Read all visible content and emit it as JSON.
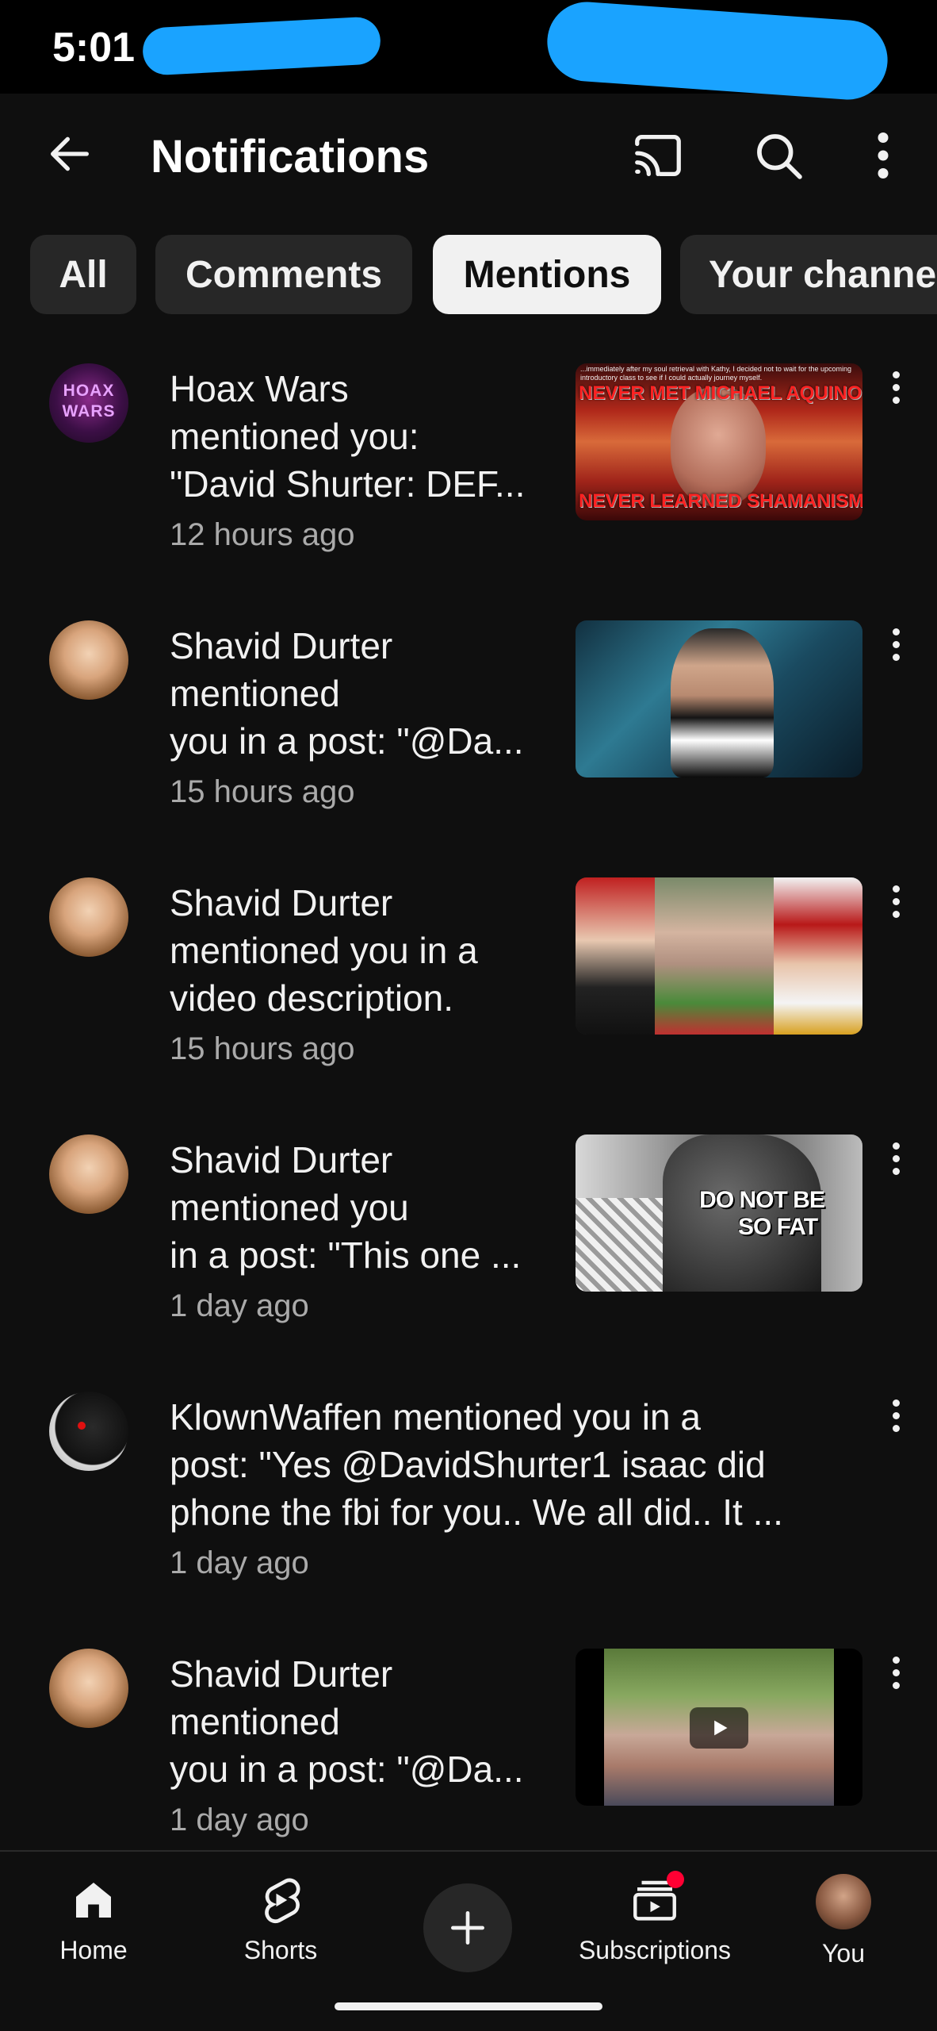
{
  "status_bar": {
    "time": "5:01"
  },
  "header": {
    "title": "Notifications"
  },
  "filters": [
    "All",
    "Comments",
    "Mentions",
    "Your channe"
  ],
  "active_filter": "Mentions",
  "notifications": [
    {
      "avatar_text": "HOAX WARS",
      "lines": [
        "Hoax Wars",
        "mentioned you:",
        "\"David Shurter: DEF..."
      ],
      "time": "12 hours ago",
      "thumb_text_top": "NEVER MET MICHAEL AQUINO",
      "thumb_text_bottom": "NEVER LEARNED SHAMANISM",
      "thumb_caption": "...immediately after my soul retrieval with Kathy, I decided not to wait for the upcoming introductory class to see if I could actually journey myself."
    },
    {
      "lines": [
        "Shavid Durter",
        "mentioned",
        "you in a post: \"@Da..."
      ],
      "time": "15 hours ago"
    },
    {
      "lines": [
        "Shavid Durter",
        "mentioned you in a",
        "video description."
      ],
      "time": "15 hours ago"
    },
    {
      "lines": [
        "Shavid Durter",
        "mentioned you",
        "in a post: \"This one ..."
      ],
      "time": "1 day ago",
      "thumb_text": [
        "DO NOT BE",
        "SO FAT"
      ]
    },
    {
      "lines": [
        "KlownWaffen mentioned you in a",
        "post: \"Yes @DavidShurter1 isaac did",
        "phone the fbi for you.. We all did.. It ..."
      ],
      "time": "1 day ago"
    },
    {
      "lines": [
        "Shavid Durter",
        "mentioned",
        "you in a post: \"@Da..."
      ],
      "time": "1 day ago"
    }
  ],
  "bottom_nav": {
    "home": "Home",
    "shorts": "Shorts",
    "subscriptions": "Subscriptions",
    "you": "You"
  },
  "colors": {
    "background": "#0f0f0f",
    "chip": "#272727",
    "active_chip": "#f1f1f1",
    "badge": "#ff0033",
    "scribble": "#1aa3ff"
  }
}
